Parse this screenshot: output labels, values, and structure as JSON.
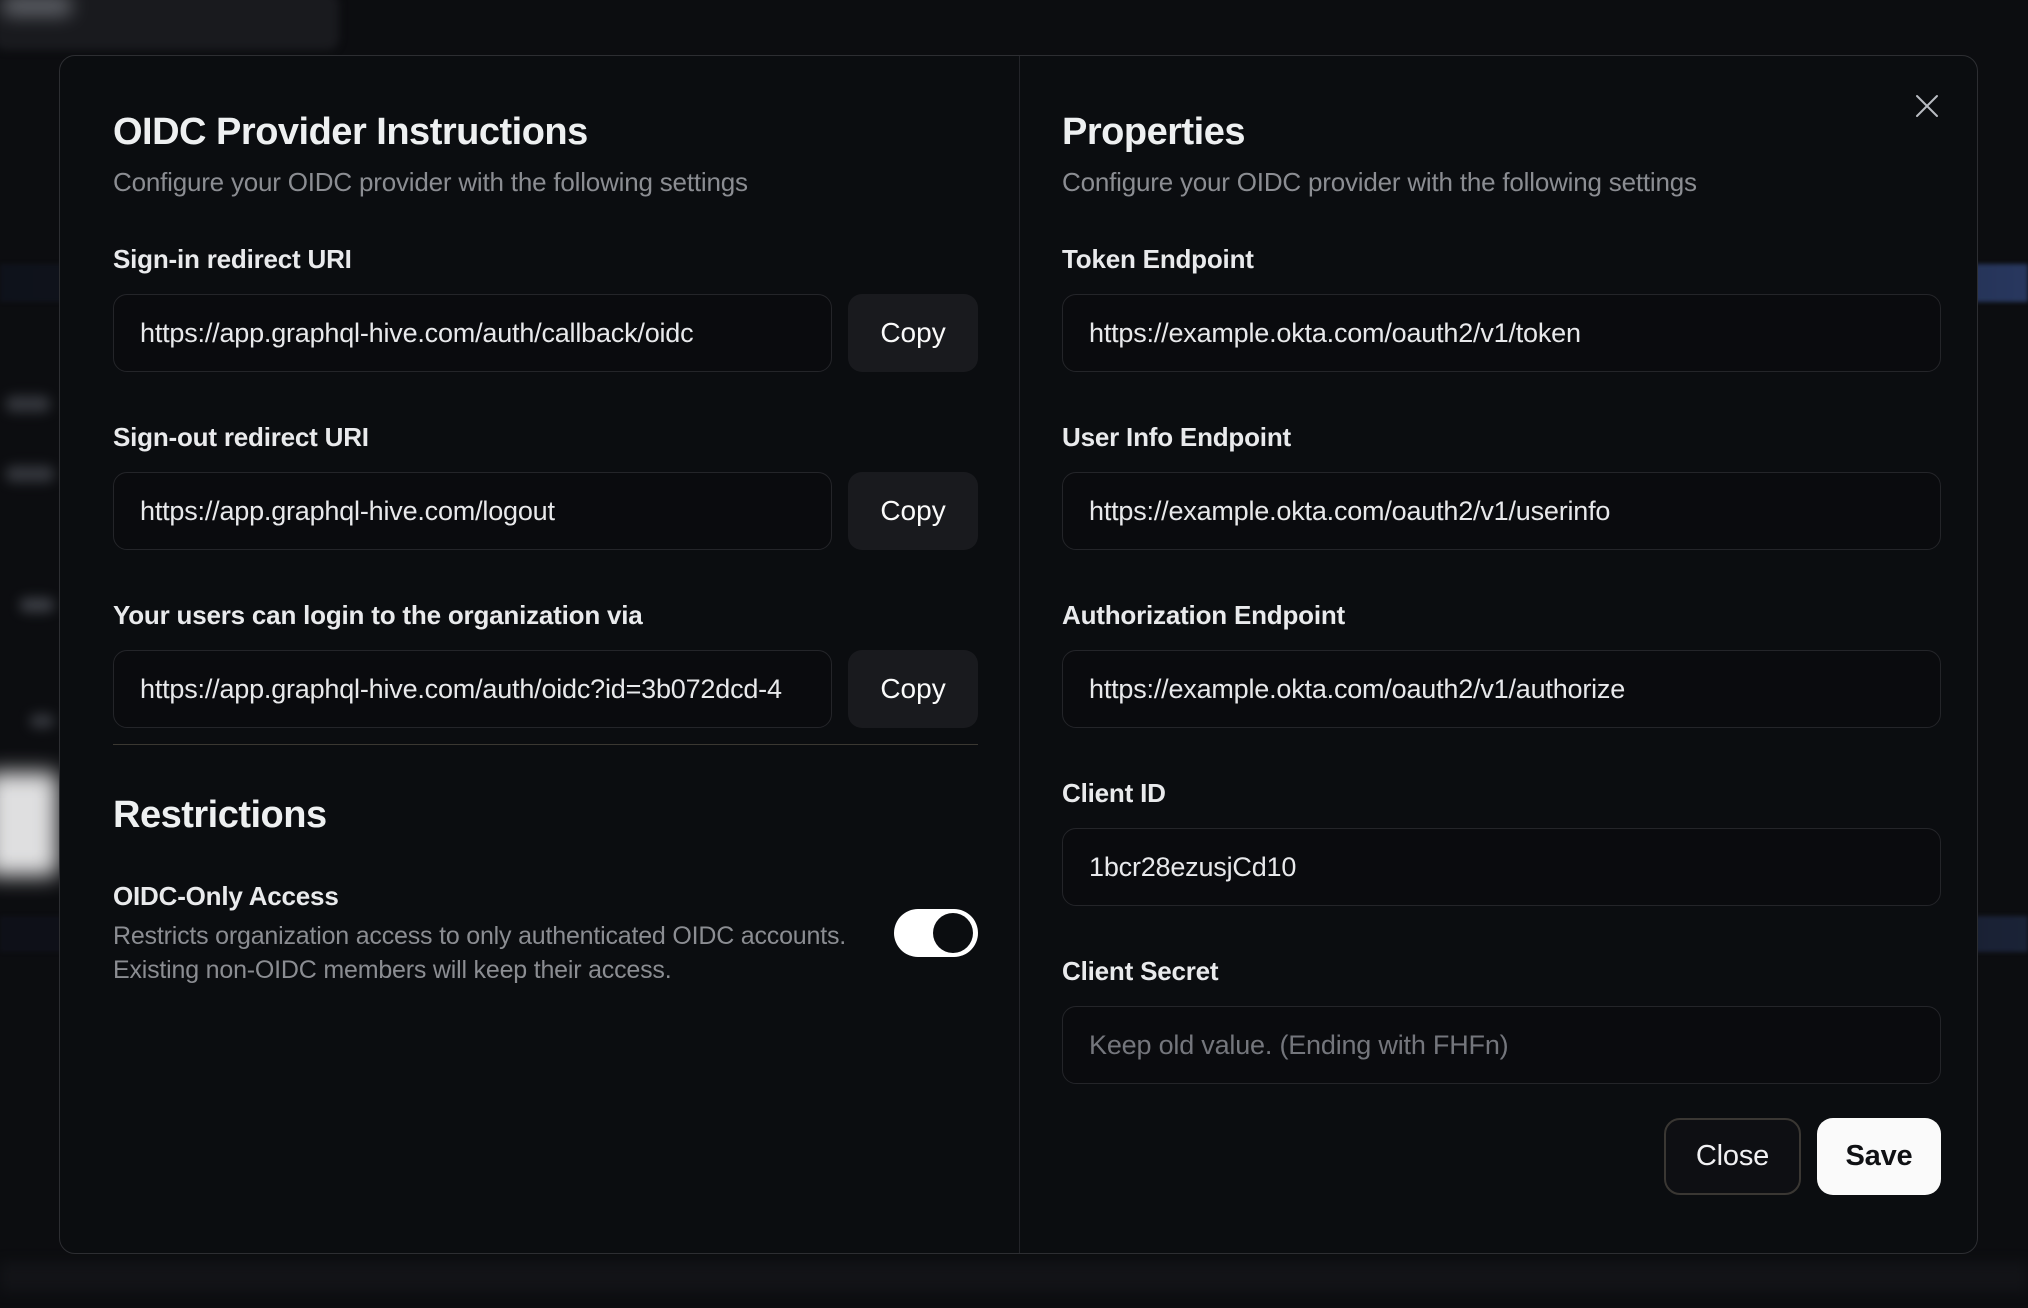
{
  "modal": {
    "left": {
      "title": "OIDC Provider Instructions",
      "subtitle": "Configure your OIDC provider with the following settings",
      "fields": [
        {
          "label": "Sign-in redirect URI",
          "value": "https://app.graphql-hive.com/auth/callback/oidc",
          "button": "Copy"
        },
        {
          "label": "Sign-out redirect URI",
          "value": "https://app.graphql-hive.com/logout",
          "button": "Copy"
        },
        {
          "label": "Your users can login to the organization via",
          "value": "https://app.graphql-hive.com/auth/oidc?id=3b072dcd-4",
          "button": "Copy"
        }
      ],
      "restrictions": {
        "title": "Restrictions",
        "toggle_label": "OIDC-Only Access",
        "toggle_description_line1": "Restricts organization access to only authenticated OIDC accounts.",
        "toggle_description_line2": "Existing non-OIDC members will keep their access.",
        "toggle_on": true
      }
    },
    "right": {
      "title": "Properties",
      "subtitle": "Configure your OIDC provider with the following settings",
      "fields": [
        {
          "label": "Token Endpoint",
          "value": "https://example.okta.com/oauth2/v1/token"
        },
        {
          "label": "User Info Endpoint",
          "value": "https://example.okta.com/oauth2/v1/userinfo"
        },
        {
          "label": "Authorization Endpoint",
          "value": "https://example.okta.com/oauth2/v1/authorize"
        },
        {
          "label": "Client ID",
          "value": "1bcr28ezusjCd10"
        },
        {
          "label": "Client Secret",
          "value": "",
          "placeholder": "Keep old value. (Ending with FHFn)"
        }
      ],
      "buttons": {
        "close": "Close",
        "save": "Save"
      }
    },
    "colors": {
      "modal_background": "#0b0d10",
      "accent_button": "#fafafa",
      "toggle_track_on": "#ffffff",
      "toggle_knob": "#0b0d10",
      "muted_text": "#8b8d92"
    }
  }
}
